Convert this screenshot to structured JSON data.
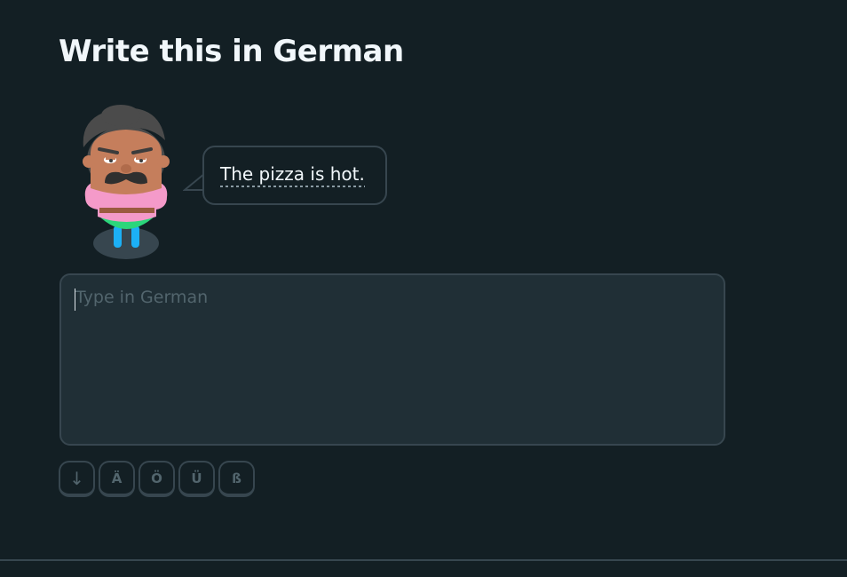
{
  "header": {
    "title": "Write this in German"
  },
  "prompt": {
    "sentence": "The pizza is hot."
  },
  "answer": {
    "value": "",
    "placeholder": "Type in German"
  },
  "special_keys": {
    "toggle": "↓",
    "a_umlaut": "Ä",
    "o_umlaut": "Ö",
    "u_umlaut": "Ü",
    "eszett": "ß"
  },
  "colors": {
    "background": "#131f24",
    "text": "#f1f7fb",
    "border": "#37464f",
    "input_background": "#202f36",
    "muted": "#52656d"
  }
}
